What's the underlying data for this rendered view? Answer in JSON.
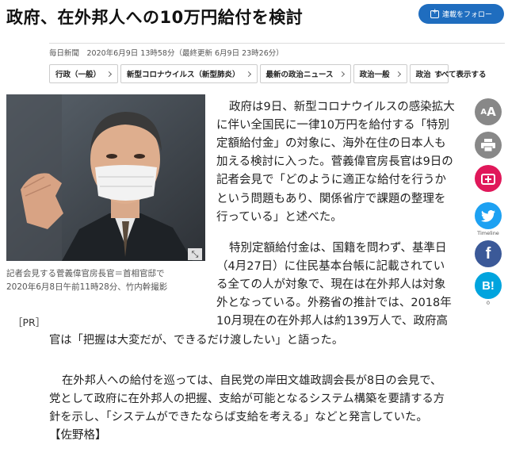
{
  "headline": "政府、在外邦人への10万円給付を検討",
  "follow_button": "連載をフォロー",
  "dateline": "毎日新聞　2020年6月9日 13時58分（最終更新 6月9日 23時26分）",
  "tags": [
    "行政（一般）",
    "新型コロナウイルス（新型肺炎）",
    "最新の政治ニュース",
    "政治一般",
    "政治"
  ],
  "show_all": "すべて表示する",
  "photo_caption": [
    "記者会見する菅義偉官房長官＝首相官邸で",
    "2020年6月8日午前11時28分、竹内幹撮影"
  ],
  "pr_label": "［PR］",
  "article": {
    "p1": [
      "政府は9日、新型コロナウイルスの感染拡大",
      "に伴い全国民に一律10万円を給付する「特別",
      "定額給付金」の対象に、海外在住の日本人も",
      "加える検討に入った。菅義偉官房長官は9日の",
      "記者会見で「どのように適正な給付を行うか",
      "という問題もあり、関係省庁で課題の整理を",
      "行っている」と述べた。"
    ],
    "p2": [
      "特別定額給付金は、国籍を問わず、基準日",
      "（4月27日）に住民基本台帳に記載されてい",
      "る全ての人が対象で、現在は在外邦人は対象",
      "外となっている。外務省の推計では、2018年",
      "10月現在の在外邦人は約139万人で、政府高",
      "官は「把握は大変だが、できるだけ渡したい」と語った。"
    ],
    "p3": [
      "在外邦人への給付を巡っては、自民党の岸田文雄政調会長が8日の会見で、",
      "党として政府に在外邦人の把握、支給が可能となるシステム構築を要請する方",
      "針を示し、「システムができたならば支給を考える」などと発言していた。",
      "【佐野格】"
    ]
  },
  "share": {
    "font_size_label": "A",
    "font_size_small": "A",
    "twitter_label": "Timeline",
    "twitter_count": "",
    "hatena_label": "B!",
    "hatena_count": "0"
  },
  "colors": {
    "follow_bg": "#1f6dbf",
    "font_btn": "#888888",
    "print_btn": "#888888",
    "save_btn": "#e0185a",
    "twitter": "#1da1f2",
    "facebook": "#3b5998",
    "hatena": "#00a4de"
  }
}
